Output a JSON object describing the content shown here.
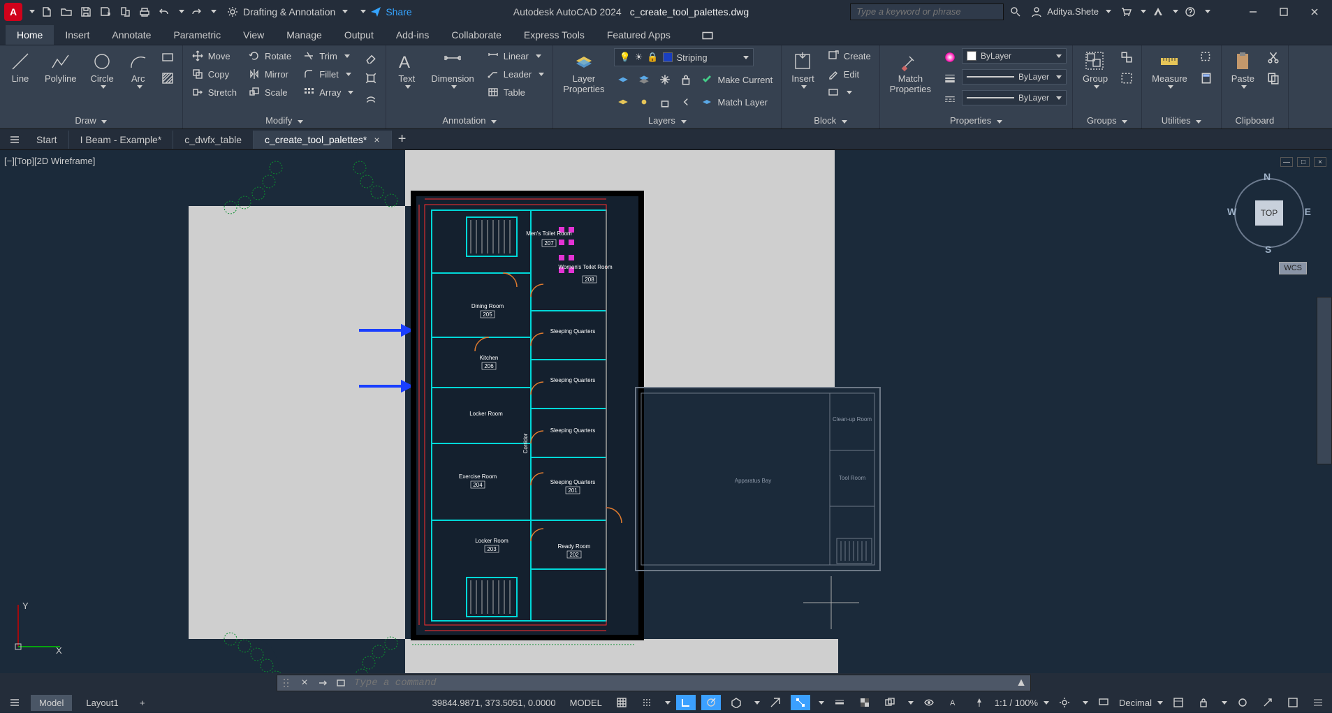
{
  "app": {
    "name": "Autodesk AutoCAD 2024",
    "filename": "c_create_tool_palettes.dwg"
  },
  "user": "Aditya.Shete",
  "workspace": "Drafting & Annotation",
  "share_label": "Share",
  "search_placeholder": "Type a keyword or phrase",
  "ribbon_tabs": [
    "Home",
    "Insert",
    "Annotate",
    "Parametric",
    "View",
    "Manage",
    "Output",
    "Add-ins",
    "Collaborate",
    "Express Tools",
    "Featured Apps"
  ],
  "ribbon_active": 0,
  "panels": {
    "draw": {
      "label": "Draw",
      "items": [
        "Line",
        "Polyline",
        "Circle",
        "Arc"
      ]
    },
    "modify": {
      "label": "Modify",
      "move": "Move",
      "copy": "Copy",
      "stretch": "Stretch",
      "rotate": "Rotate",
      "mirror": "Mirror",
      "scale": "Scale",
      "trim": "Trim",
      "fillet": "Fillet",
      "array": "Array"
    },
    "annotation": {
      "label": "Annotation",
      "text": "Text",
      "dimension": "Dimension",
      "linear": "Linear",
      "leader": "Leader",
      "table": "Table"
    },
    "layers": {
      "label": "Layers",
      "layer_properties": "Layer\nProperties",
      "current": "Striping",
      "make_current": "Make Current",
      "match_layer": "Match Layer"
    },
    "block": {
      "label": "Block",
      "insert": "Insert",
      "create": "Create",
      "edit": "Edit"
    },
    "properties": {
      "label": "Properties",
      "match": "Match\nProperties",
      "color": "ByLayer",
      "lineweight": "ByLayer",
      "linetype": "ByLayer"
    },
    "groups": {
      "label": "Groups",
      "group": "Group"
    },
    "utilities": {
      "label": "Utilities",
      "measure": "Measure"
    },
    "clipboard": {
      "label": "Clipboard",
      "paste": "Paste"
    }
  },
  "doc_tabs": [
    {
      "label": "Start",
      "dirty": false
    },
    {
      "label": "I Beam - Example*",
      "dirty": true
    },
    {
      "label": "c_dwfx_table",
      "dirty": false
    },
    {
      "label": "c_create_tool_palettes*",
      "dirty": true,
      "active": true
    }
  ],
  "viewport_label": "[−][Top][2D Wireframe]",
  "viewcube": {
    "face": "TOP",
    "n": "N",
    "s": "S",
    "e": "E",
    "w": "W",
    "wcs": "WCS"
  },
  "rooms": {
    "mens_toilet": "Men's Toilet\nRoom",
    "mens_toilet_no": "207",
    "womens_toilet": "Women's\nToilet Room",
    "womens_toilet_no": "208",
    "dining": "Dining Room",
    "dining_no": "205",
    "kitchen": "Kitchen",
    "kitchen_no": "206",
    "locker": "Locker Room",
    "exercise": "Exercise Room",
    "exercise_no": "204",
    "locker2": "Locker Room",
    "locker2_no": "203",
    "sleep": "Sleeping Quarters",
    "sleep_no": "201",
    "ready": "Ready Room",
    "ready_no": "202",
    "corridor": "Corridor",
    "apparatus": "Apparatus Bay",
    "cleanup": "Clean-up\nRoom",
    "tool": "Tool Room"
  },
  "cmd_placeholder": "Type a command",
  "layout_tabs": [
    "Model",
    "Layout1"
  ],
  "status": {
    "coords": "39844.9871, 373.5051, 0.0000",
    "space": "MODEL",
    "scale": "1:1 / 100%",
    "units": "Decimal"
  },
  "colors": {
    "accent": "#3ba0ff",
    "wall": "#00e5e5",
    "dim": "#ff2e2e",
    "grid": "#2a3442"
  }
}
